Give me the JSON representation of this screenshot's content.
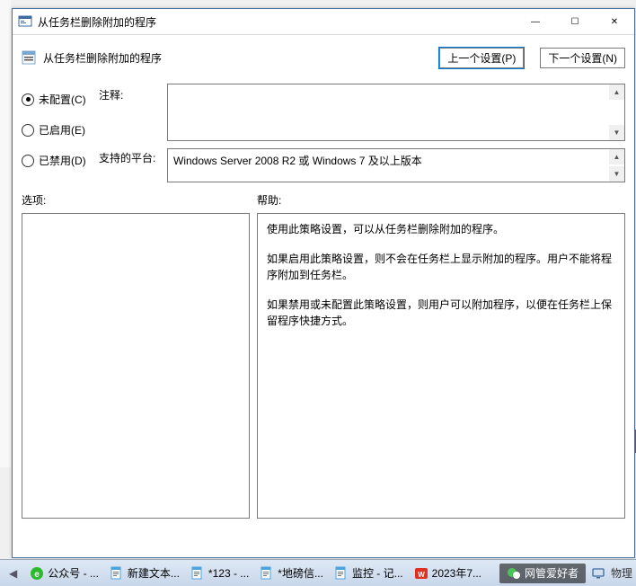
{
  "window": {
    "title": "从任务栏删除附加的程序",
    "minimize_glyph": "—",
    "maximize_glyph": "☐",
    "close_glyph": "✕"
  },
  "header": {
    "title": "从任务栏删除附加的程序",
    "prev_btn": "上一个设置(P)",
    "next_btn": "下一个设置(N)"
  },
  "radios": {
    "not_configured": "未配置(C)",
    "enabled": "已启用(E)",
    "disabled": "已禁用(D)",
    "selected": "not_configured"
  },
  "labels": {
    "comment": "注释:",
    "platform": "支持的平台:",
    "options": "选项:",
    "help": "帮助:"
  },
  "fields": {
    "comment_value": "",
    "platform_value": "Windows Server 2008 R2 或 Windows 7 及以上版本"
  },
  "help_text": {
    "p1": "使用此策略设置，可以从任务栏删除附加的程序。",
    "p2": "如果启用此策略设置，则不会在任务栏上显示附加的程序。用户不能将程序附加到任务栏。",
    "p3": "如果禁用或未配置此策略设置，则用户可以附加程序，以便在任务栏上保留程序快捷方式。"
  },
  "taskbar": {
    "items": [
      {
        "icon": "360-icon",
        "color": "#2eb82e",
        "label": "公众号 - ..."
      },
      {
        "icon": "notepad-icon",
        "color": "#4aa3df",
        "label": "新建文本..."
      },
      {
        "icon": "notepad-icon",
        "color": "#4aa3df",
        "label": "*123 - ..."
      },
      {
        "icon": "notepad-icon",
        "color": "#4aa3df",
        "label": "*地磅信..."
      },
      {
        "icon": "notepad-icon",
        "color": "#4aa3df",
        "label": "监控 - 记..."
      },
      {
        "icon": "wps-icon",
        "color": "#e03020",
        "label": "2023年7..."
      }
    ],
    "tray_label": "物理",
    "wechat_banner": "网管爱好者"
  }
}
